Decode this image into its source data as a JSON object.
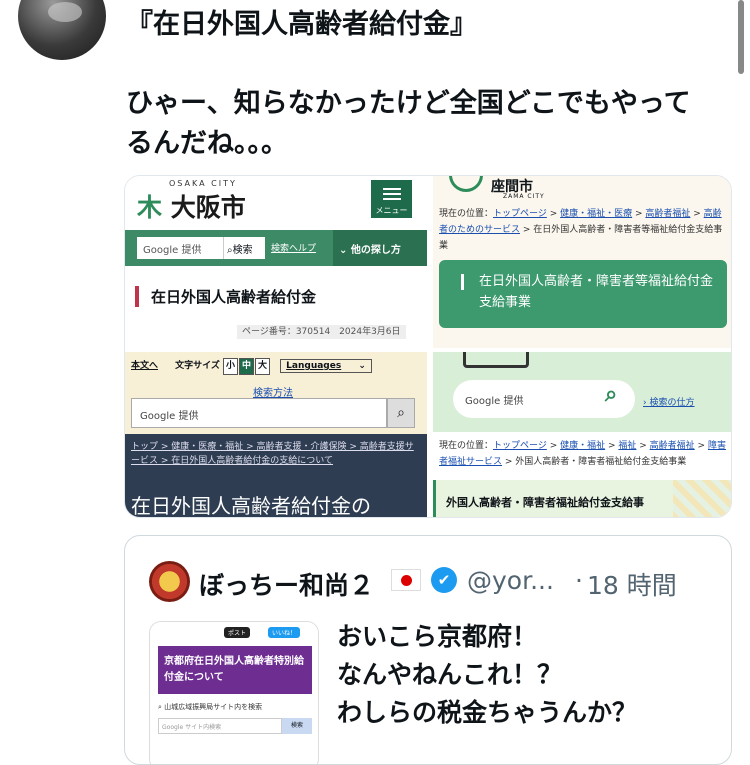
{
  "post": {
    "title": "『在日外国人高齢者給付金』",
    "body_line1": "ひゃー、知らなかったけど全国どこでもやって",
    "body_line2": "るんだね。。。"
  },
  "media": {
    "osaka_top": {
      "city_small": "OSAKA CITY",
      "logo": "大阪市",
      "menu": "メニュー",
      "search_placeholder": "Google 提供",
      "search_button": "検索",
      "search_help": "検索ヘルプ",
      "other_search": "他の探し方",
      "page_title": "在日外国人高齢者給付金",
      "page_number": "ページ番号：370514　2024年3月6日"
    },
    "zama_top": {
      "city": "座間市",
      "city_small": "ZAMA CITY",
      "crumb_prefix": "現在の位置：",
      "crumb_links": [
        "トップページ",
        "健康・福祉・医療",
        "高齢者福祉",
        "高齢者のためのサービス"
      ],
      "crumb_tail": "在日外国人高齢者・障害者等福祉給付金支給事業",
      "banner": "在日外国人高齢者・障害者等福祉給付金支給事業"
    },
    "osaka_bottom": {
      "main_text": "本文へ",
      "text_size": "文字サイズ",
      "size_small": "小",
      "size_mid": "中",
      "size_large": "大",
      "languages": "Languages",
      "search_method": "検索方法",
      "search_placeholder": "Google 提供",
      "crumb": "トップ > 健康・医療・福祉 > 高齢者支援・介護保険 > 高齢者支援サービス > 在日外国人高齢者給付金の支給について",
      "big_title": "在日外国人高齢者給付金の"
    },
    "zama_bottom": {
      "search_placeholder": "Google 提供",
      "search_howto": "検索の仕方",
      "crumb_prefix": "現在の位置：",
      "crumb_links": [
        "トップページ",
        "健康・福祉",
        "福祉",
        "高齢者福祉",
        "障害者福祉サービス"
      ],
      "crumb_tail": "外国人高齢者・障害者福祉給付金支給事業",
      "section": "外国人高齢者・障害者福祉給付金支給事"
    }
  },
  "quote": {
    "name": "ぼっちー和尚２",
    "verified": "✔",
    "handle": "@yor...",
    "dot": "·",
    "time": "18 時間",
    "thumb": {
      "post": "ポスト",
      "like": "いいね！",
      "headline": "京都府在日外国人高齢者特別給付金について",
      "sub": "山城広域振興局サイト内を検索",
      "search_placeholder": "Google サイト内検索",
      "search_button": "検索"
    },
    "text_line1": "おいこら京都府！",
    "text_line2": "なんやねんこれ！？",
    "text_line3": "わしらの税金ちゃうんか？"
  }
}
